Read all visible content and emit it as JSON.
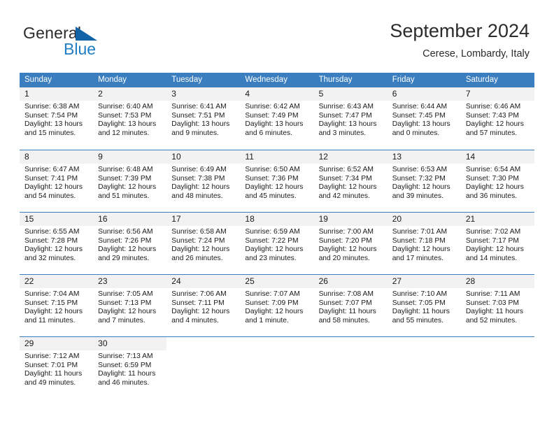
{
  "brand": {
    "word_one": "General",
    "word_two": "Blue"
  },
  "header": {
    "title": "September 2024",
    "location": "Cerese, Lombardy, Italy"
  },
  "calendar": {
    "weekday_headers": [
      "Sunday",
      "Monday",
      "Tuesday",
      "Wednesday",
      "Thursday",
      "Friday",
      "Saturday"
    ],
    "colors": {
      "header_blue": "#3a7ebf",
      "daynum_band": "#f2f2f2",
      "logo_blue": "#1f7ec4",
      "text": "#1a1a1a"
    },
    "weeks": [
      [
        {
          "day": "1",
          "sunrise": "Sunrise: 6:38 AM",
          "sunset": "Sunset: 7:54 PM",
          "daylight": "Daylight: 13 hours and 15 minutes."
        },
        {
          "day": "2",
          "sunrise": "Sunrise: 6:40 AM",
          "sunset": "Sunset: 7:53 PM",
          "daylight": "Daylight: 13 hours and 12 minutes."
        },
        {
          "day": "3",
          "sunrise": "Sunrise: 6:41 AM",
          "sunset": "Sunset: 7:51 PM",
          "daylight": "Daylight: 13 hours and 9 minutes."
        },
        {
          "day": "4",
          "sunrise": "Sunrise: 6:42 AM",
          "sunset": "Sunset: 7:49 PM",
          "daylight": "Daylight: 13 hours and 6 minutes."
        },
        {
          "day": "5",
          "sunrise": "Sunrise: 6:43 AM",
          "sunset": "Sunset: 7:47 PM",
          "daylight": "Daylight: 13 hours and 3 minutes."
        },
        {
          "day": "6",
          "sunrise": "Sunrise: 6:44 AM",
          "sunset": "Sunset: 7:45 PM",
          "daylight": "Daylight: 13 hours and 0 minutes."
        },
        {
          "day": "7",
          "sunrise": "Sunrise: 6:46 AM",
          "sunset": "Sunset: 7:43 PM",
          "daylight": "Daylight: 12 hours and 57 minutes."
        }
      ],
      [
        {
          "day": "8",
          "sunrise": "Sunrise: 6:47 AM",
          "sunset": "Sunset: 7:41 PM",
          "daylight": "Daylight: 12 hours and 54 minutes."
        },
        {
          "day": "9",
          "sunrise": "Sunrise: 6:48 AM",
          "sunset": "Sunset: 7:39 PM",
          "daylight": "Daylight: 12 hours and 51 minutes."
        },
        {
          "day": "10",
          "sunrise": "Sunrise: 6:49 AM",
          "sunset": "Sunset: 7:38 PM",
          "daylight": "Daylight: 12 hours and 48 minutes."
        },
        {
          "day": "11",
          "sunrise": "Sunrise: 6:50 AM",
          "sunset": "Sunset: 7:36 PM",
          "daylight": "Daylight: 12 hours and 45 minutes."
        },
        {
          "day": "12",
          "sunrise": "Sunrise: 6:52 AM",
          "sunset": "Sunset: 7:34 PM",
          "daylight": "Daylight: 12 hours and 42 minutes."
        },
        {
          "day": "13",
          "sunrise": "Sunrise: 6:53 AM",
          "sunset": "Sunset: 7:32 PM",
          "daylight": "Daylight: 12 hours and 39 minutes."
        },
        {
          "day": "14",
          "sunrise": "Sunrise: 6:54 AM",
          "sunset": "Sunset: 7:30 PM",
          "daylight": "Daylight: 12 hours and 36 minutes."
        }
      ],
      [
        {
          "day": "15",
          "sunrise": "Sunrise: 6:55 AM",
          "sunset": "Sunset: 7:28 PM",
          "daylight": "Daylight: 12 hours and 32 minutes."
        },
        {
          "day": "16",
          "sunrise": "Sunrise: 6:56 AM",
          "sunset": "Sunset: 7:26 PM",
          "daylight": "Daylight: 12 hours and 29 minutes."
        },
        {
          "day": "17",
          "sunrise": "Sunrise: 6:58 AM",
          "sunset": "Sunset: 7:24 PM",
          "daylight": "Daylight: 12 hours and 26 minutes."
        },
        {
          "day": "18",
          "sunrise": "Sunrise: 6:59 AM",
          "sunset": "Sunset: 7:22 PM",
          "daylight": "Daylight: 12 hours and 23 minutes."
        },
        {
          "day": "19",
          "sunrise": "Sunrise: 7:00 AM",
          "sunset": "Sunset: 7:20 PM",
          "daylight": "Daylight: 12 hours and 20 minutes."
        },
        {
          "day": "20",
          "sunrise": "Sunrise: 7:01 AM",
          "sunset": "Sunset: 7:18 PM",
          "daylight": "Daylight: 12 hours and 17 minutes."
        },
        {
          "day": "21",
          "sunrise": "Sunrise: 7:02 AM",
          "sunset": "Sunset: 7:17 PM",
          "daylight": "Daylight: 12 hours and 14 minutes."
        }
      ],
      [
        {
          "day": "22",
          "sunrise": "Sunrise: 7:04 AM",
          "sunset": "Sunset: 7:15 PM",
          "daylight": "Daylight: 12 hours and 11 minutes."
        },
        {
          "day": "23",
          "sunrise": "Sunrise: 7:05 AM",
          "sunset": "Sunset: 7:13 PM",
          "daylight": "Daylight: 12 hours and 7 minutes."
        },
        {
          "day": "24",
          "sunrise": "Sunrise: 7:06 AM",
          "sunset": "Sunset: 7:11 PM",
          "daylight": "Daylight: 12 hours and 4 minutes."
        },
        {
          "day": "25",
          "sunrise": "Sunrise: 7:07 AM",
          "sunset": "Sunset: 7:09 PM",
          "daylight": "Daylight: 12 hours and 1 minute."
        },
        {
          "day": "26",
          "sunrise": "Sunrise: 7:08 AM",
          "sunset": "Sunset: 7:07 PM",
          "daylight": "Daylight: 11 hours and 58 minutes."
        },
        {
          "day": "27",
          "sunrise": "Sunrise: 7:10 AM",
          "sunset": "Sunset: 7:05 PM",
          "daylight": "Daylight: 11 hours and 55 minutes."
        },
        {
          "day": "28",
          "sunrise": "Sunrise: 7:11 AM",
          "sunset": "Sunset: 7:03 PM",
          "daylight": "Daylight: 11 hours and 52 minutes."
        }
      ],
      [
        {
          "day": "29",
          "sunrise": "Sunrise: 7:12 AM",
          "sunset": "Sunset: 7:01 PM",
          "daylight": "Daylight: 11 hours and 49 minutes."
        },
        {
          "day": "30",
          "sunrise": "Sunrise: 7:13 AM",
          "sunset": "Sunset: 6:59 PM",
          "daylight": "Daylight: 11 hours and 46 minutes."
        },
        {
          "day": "",
          "sunrise": "",
          "sunset": "",
          "daylight": ""
        },
        {
          "day": "",
          "sunrise": "",
          "sunset": "",
          "daylight": ""
        },
        {
          "day": "",
          "sunrise": "",
          "sunset": "",
          "daylight": ""
        },
        {
          "day": "",
          "sunrise": "",
          "sunset": "",
          "daylight": ""
        },
        {
          "day": "",
          "sunrise": "",
          "sunset": "",
          "daylight": ""
        }
      ]
    ]
  }
}
